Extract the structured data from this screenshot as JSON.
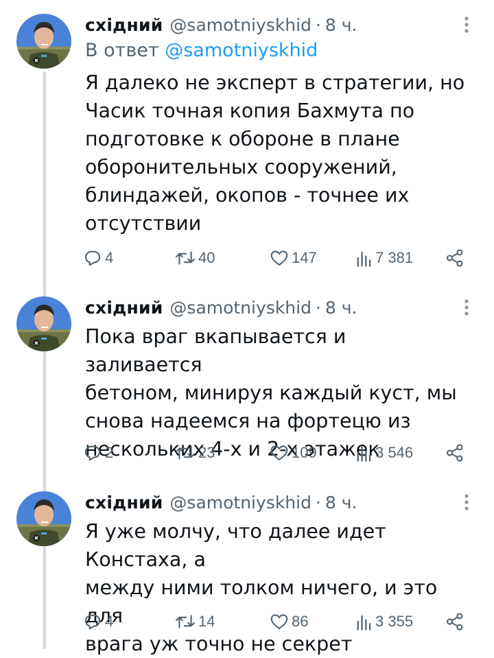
{
  "tweets": [
    {
      "name": "східний",
      "handle": "@samotniyskhid",
      "separator": "·",
      "time": "8 ч.",
      "reply_prefix": "В ответ",
      "reply_mention": "@samotniyskhid",
      "text": "Я далеко не эксперт в стратегии, но\nЧасик точная копия Бахмута по\nподготовке к обороне в плане\nоборонительных сооружений,\nблиндажей, окопов - точнее их\nотсутствии",
      "replies": "4",
      "retweets": "40",
      "likes": "147",
      "views": "7 381"
    },
    {
      "name": "східний",
      "handle": "@samotniyskhid",
      "separator": "·",
      "time": "8 ч.",
      "text": "Пока враг вкапывается и заливается\nбетоном, минируя каждый куст, мы\nснова надеемся на фортецю из\nнескольких 4-х и 2-х этажек",
      "replies": "2",
      "retweets": "23",
      "likes": "109",
      "views": "3 546"
    },
    {
      "name": "східний",
      "handle": "@samotniyskhid",
      "separator": "·",
      "time": "8 ч.",
      "text": "Я уже молчу, что далее идет Констаха, а\nмежду ними толком ничего, и это для\nврага уж точно не секрет",
      "replies": "4",
      "retweets": "14",
      "likes": "86",
      "views": "3 355"
    }
  ],
  "icons": {
    "reply": "reply-icon",
    "retweet": "retweet-icon",
    "like": "heart-icon",
    "views": "views-icon",
    "share": "share-icon",
    "more": "more-icon"
  },
  "colors": {
    "text": "#0f1419",
    "secondary": "#536471",
    "link": "#1d9bf0",
    "thread_line": "#cfd9de"
  }
}
